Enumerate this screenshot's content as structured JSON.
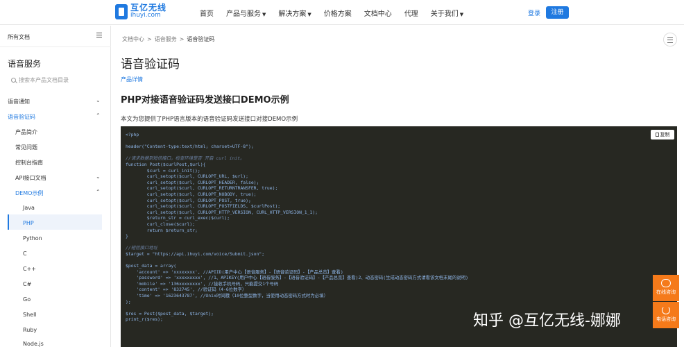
{
  "header": {
    "logo_cn": "互亿无线",
    "logo_en": "ihuyi.com",
    "nav": [
      {
        "label": "首页",
        "caret": false
      },
      {
        "label": "产品与服务",
        "caret": true
      },
      {
        "label": "解决方案",
        "caret": true
      },
      {
        "label": "价格方案",
        "caret": false
      },
      {
        "label": "文档中心",
        "caret": false
      },
      {
        "label": "代理",
        "caret": false
      },
      {
        "label": "关于我们",
        "caret": true
      }
    ],
    "caret_glyph": "▼",
    "login": "登录",
    "register": "注册"
  },
  "sidebar": {
    "all_docs": "所有文档",
    "title": "语音服务",
    "search_placeholder": "搜索本产品文档目录",
    "items": [
      {
        "label": "语音通知",
        "chev": "⌄"
      },
      {
        "label": "语音验证码",
        "chev": "⌃"
      },
      {
        "label": "产品简介",
        "chev": ""
      },
      {
        "label": "常见问题",
        "chev": ""
      },
      {
        "label": "控制台指南",
        "chev": ""
      },
      {
        "label": "API接口文档",
        "chev": "⌄"
      },
      {
        "label": "DEMO示例",
        "chev": "⌃"
      },
      {
        "label": "Java",
        "chev": ""
      },
      {
        "label": "PHP",
        "chev": ""
      },
      {
        "label": "Python",
        "chev": ""
      },
      {
        "label": "C",
        "chev": ""
      },
      {
        "label": "C++",
        "chev": ""
      },
      {
        "label": "C#",
        "chev": ""
      },
      {
        "label": "Go",
        "chev": ""
      },
      {
        "label": "Shell",
        "chev": ""
      },
      {
        "label": "Ruby",
        "chev": ""
      },
      {
        "label": "Node.js",
        "chev": ""
      }
    ]
  },
  "breadcrumb": {
    "items": [
      "文档中心",
      "语音服务",
      "语音验证码"
    ],
    "sep": ">"
  },
  "main": {
    "title": "语音验证码",
    "detail_link": "产品详情",
    "section_title": "PHP对接语音验证码发送接口DEMO示例",
    "intro": "本文为您提供了PHP语言版本的语音验证码发送接口对接DEMO示例",
    "copy_label": "复制"
  },
  "code": [
    {
      "t": "<?php",
      "c": false
    },
    {
      "t": "",
      "c": false
    },
    {
      "t": "header(\"Content-type:text/html; charset=UTF-8\");",
      "c": false
    },
    {
      "t": "",
      "c": false
    },
    {
      "t": "//请求数据到短信接口，检查环境是否 开启 curl init。",
      "c": true
    },
    {
      "t": "function Post($curlPost,$url){",
      "c": false
    },
    {
      "t": "        $curl = curl_init();",
      "c": false
    },
    {
      "t": "        curl_setopt($curl, CURLOPT_URL, $url);",
      "c": false
    },
    {
      "t": "        curl_setopt($curl, CURLOPT_HEADER, false);",
      "c": false
    },
    {
      "t": "        curl_setopt($curl, CURLOPT_RETURNTRANSFER, true);",
      "c": false
    },
    {
      "t": "        curl_setopt($curl, CURLOPT_NOBODY, true);",
      "c": false
    },
    {
      "t": "        curl_setopt($curl, CURLOPT_POST, true);",
      "c": false
    },
    {
      "t": "        curl_setopt($curl, CURLOPT_POSTFIELDS, $curlPost);",
      "c": false
    },
    {
      "t": "        curl_setopt($curl, CURLOPT_HTTP_VERSION, CURL_HTTP_VERSION_1_1);",
      "c": false
    },
    {
      "t": "        $return_str = curl_exec($curl);",
      "c": false
    },
    {
      "t": "        curl_close($curl);",
      "c": false
    },
    {
      "t": "        return $return_str;",
      "c": false
    },
    {
      "t": "}",
      "c": false
    },
    {
      "t": "",
      "c": false
    },
    {
      "t": "//短信接口地址",
      "c": true
    },
    {
      "t": "$target = \"https://api.ihuyi.com/voice/Submit.json\";",
      "c": false
    },
    {
      "t": "",
      "c": false
    },
    {
      "t": "$post_data = array(",
      "c": false
    },
    {
      "t": "    'account' => 'xxxxxxxx', //APIID(用户中心【语音服务】-【语音验证码】-【产品总览】查看)",
      "c": false
    },
    {
      "t": "    'password' => 'xxxxxxxxx', //1、APIKEY(用户中心【语音服务】-【语音验证码】-【产品总览】查看)2、动态密码(生成动态密码方式请看该文档末尾的说明)",
      "c": false
    },
    {
      "t": "    'mobile' => '136xxxxxxxx', //接收手机号码，只能提交1个号码",
      "c": false
    },
    {
      "t": "    'content' => '832745', //验证码（4-6位数字）",
      "c": false
    },
    {
      "t": "    'time' => '1623643787', //Unix时间戳（10位整型数字，当使用动态密码方式时为必填）",
      "c": false
    },
    {
      "t": ");",
      "c": false
    },
    {
      "t": "",
      "c": false
    },
    {
      "t": "$res = Post($post_data, $target);",
      "c": false
    },
    {
      "t": "print_r($res);",
      "c": false
    }
  ],
  "watermark": "知乎 @互亿无线-娜娜",
  "float": {
    "online": "在线咨询",
    "call": "电话咨询"
  },
  "colors": {
    "brand": "#1f79e0",
    "code_bg": "#272822",
    "float_orange": "#f57a1a"
  }
}
